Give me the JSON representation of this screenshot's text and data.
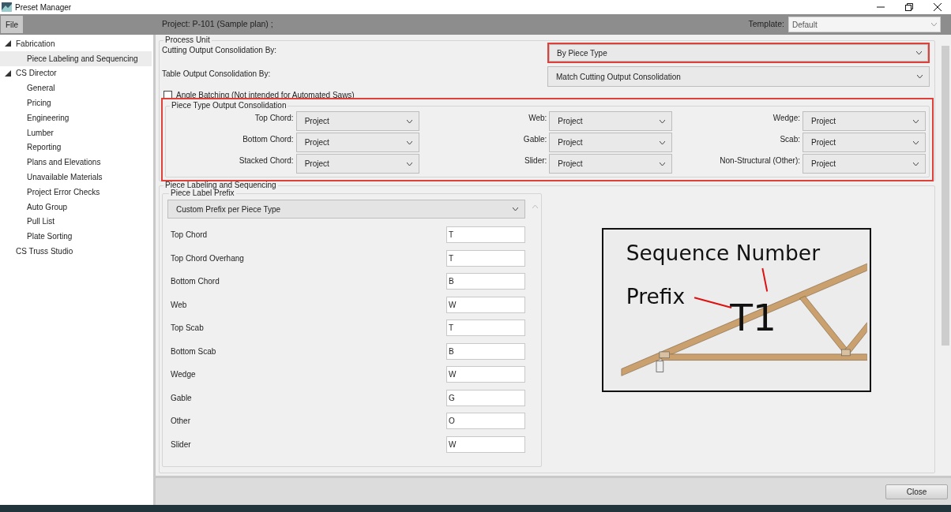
{
  "window": {
    "title": "Preset Manager"
  },
  "toolbar": {
    "menu": "File",
    "project": "Project: P-101 (Sample plan) ;",
    "template_label": "Template:",
    "template_value": "Default",
    "template_disabled": true
  },
  "sidebar": {
    "items": [
      {
        "label": "Fabrication",
        "expanded": true,
        "selected": false,
        "children": [
          {
            "label": "Piece Labeling and Sequencing",
            "selected": true
          }
        ]
      },
      {
        "label": "CS Director",
        "expanded": true,
        "selected": false,
        "children": [
          {
            "label": "General",
            "selected": false
          },
          {
            "label": "Pricing",
            "selected": false
          },
          {
            "label": "Engineering",
            "selected": false
          },
          {
            "label": "Lumber",
            "selected": false
          },
          {
            "label": "Reporting",
            "selected": false
          },
          {
            "label": "Plans and Elevations",
            "selected": false
          },
          {
            "label": "Unavailable Materials",
            "selected": false
          },
          {
            "label": "Project Error Checks",
            "selected": false
          },
          {
            "label": "Auto Group",
            "selected": false
          },
          {
            "label": "Pull List",
            "selected": false
          },
          {
            "label": "Plate Sorting",
            "selected": false
          }
        ]
      },
      {
        "label": "CS Truss Studio",
        "selected": false
      }
    ]
  },
  "process_unit": {
    "title": "Process Unit",
    "fields": [
      {
        "label": "Cutting Output Consolidation By:",
        "value": "By Piece Type",
        "highlighted": true
      },
      {
        "label": "Table Output Consolidation By:",
        "value": "Match Cutting Output Consolidation",
        "highlighted": false
      }
    ],
    "angle_batching": {
      "label": "Angle Batching (Not intended for Automated Saws)",
      "checked": false
    },
    "piece_type": {
      "title": "Piece Type Output Consolidation",
      "highlighted": true,
      "fields": [
        {
          "label": "Top Chord:",
          "value": "Project"
        },
        {
          "label": "Web:",
          "value": "Project"
        },
        {
          "label": "Wedge:",
          "value": "Project"
        },
        {
          "label": "Bottom Chord:",
          "value": "Project"
        },
        {
          "label": "Gable:",
          "value": "Project"
        },
        {
          "label": "Scab:",
          "value": "Project"
        },
        {
          "label": "Stacked Chord:",
          "value": "Project"
        },
        {
          "label": "Slider:",
          "value": "Project"
        },
        {
          "label": "Non-Structural (Other):",
          "value": "Project"
        }
      ]
    }
  },
  "labeling": {
    "title": "Piece Labeling and Sequencing",
    "prefix": {
      "title": "Piece Label Prefix",
      "mode": "Custom Prefix per Piece Type",
      "rows": [
        {
          "label": "Top Chord",
          "value": "T"
        },
        {
          "label": "Top Chord Overhang",
          "value": "T"
        },
        {
          "label": "Bottom Chord",
          "value": "B"
        },
        {
          "label": "Web",
          "value": "W"
        },
        {
          "label": "Top Scab",
          "value": "T"
        },
        {
          "label": "Bottom Scab",
          "value": "B"
        },
        {
          "label": "Wedge",
          "value": "W"
        },
        {
          "label": "Gable",
          "value": "G"
        },
        {
          "label": "Other",
          "value": "O"
        },
        {
          "label": "Slider",
          "value": "W"
        }
      ]
    },
    "diagram": {
      "sequence_label": "Sequence Number",
      "prefix_label": "Prefix",
      "sample": "T1"
    }
  },
  "footer": {
    "close": "Close"
  }
}
